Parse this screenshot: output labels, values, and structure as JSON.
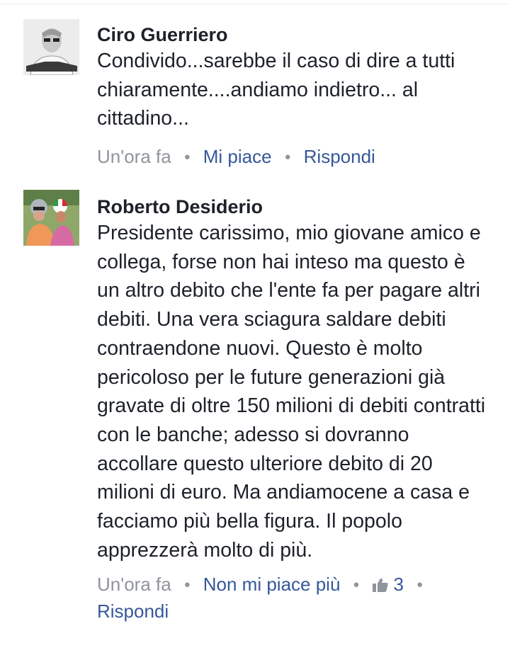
{
  "comments": [
    {
      "author": "Ciro Guerriero",
      "text": "Condivido...sarebbe il caso di dire a tutti chiaramente....andiamo indietro... al cittadino...",
      "time": "Un'ora fa",
      "like_label": "Mi piace",
      "reply_label": "Rispondi"
    },
    {
      "author": "Roberto Desiderio",
      "text": "Presidente carissimo, mio giovane amico e collega, forse non hai inteso ma questo è un altro debito che l'ente fa per pagare altri debiti. Una vera sciagura saldare debiti contraendone nuovi. Questo è molto pericoloso per le future generazioni già gravate di oltre 150 milioni di debiti contratti con le banche; adesso si dovranno accollare questo ulteriore debito di 20 milioni di euro. Ma andiamocene a casa e facciamo più bella figura. Il popolo apprezzerà molto di più.",
      "time": "Un'ora fa",
      "like_label": "Non mi piace più",
      "like_count": "3",
      "reply_label": "Rispondi"
    }
  ],
  "icons": {
    "like": "thumbs-up-icon"
  },
  "colors": {
    "link": "#365899",
    "meta": "#90949c",
    "text": "#1d2129"
  }
}
